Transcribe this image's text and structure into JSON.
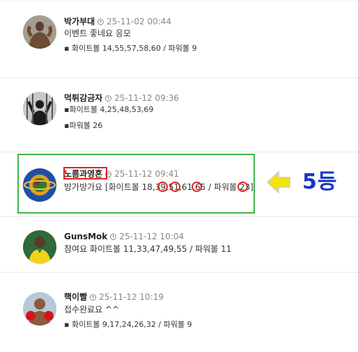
{
  "colors": {
    "highlight_box": "#3cb54a",
    "name_box": "#e02020",
    "rank": "#1536c8",
    "arrow": "#f5e400"
  },
  "posts": [
    {
      "name": "박가부대",
      "date": "25-11-02 00:44",
      "lines": [
        "이벤트 좋네요 응모",
        "▪ 화이트볼 14,55,57,58,60 / 파워볼 9"
      ],
      "avatar_icon": "bodybuilder-avatar-icon"
    },
    {
      "name": "먹튀감금자",
      "date": "25-11-12 09:36",
      "lines": [
        "▪화이트볼 4,25,48,53,69",
        "▪파워볼 26"
      ],
      "avatar_icon": "prisoner-avatar-icon"
    },
    {
      "name": "노름과영혼",
      "date": "25-11-12 09:41",
      "lines": [
        "방가방가요 [화이트볼 18,39,51,61,65 / 파워볼 23]"
      ],
      "avatar_icon": "planet-avatar-icon"
    },
    {
      "name": "GunsMok",
      "date": "25-11-12 10:04",
      "lines": [
        "참여요 화이트볼 11,33,47,49,55 / 파워볼 11"
      ],
      "avatar_icon": "soccer-player-avatar-icon"
    },
    {
      "name": "핵이빨",
      "date": "25-11-12 10:19",
      "lines": [
        "접수완료요 ^^",
        "▪ 화이트볼 9,17,24,26,32 / 파워볼 9"
      ],
      "avatar_icon": "boxer-avatar-icon"
    }
  ],
  "annotation": {
    "rank_label": "5등",
    "arrow_icon": "left-arrow-icon"
  }
}
